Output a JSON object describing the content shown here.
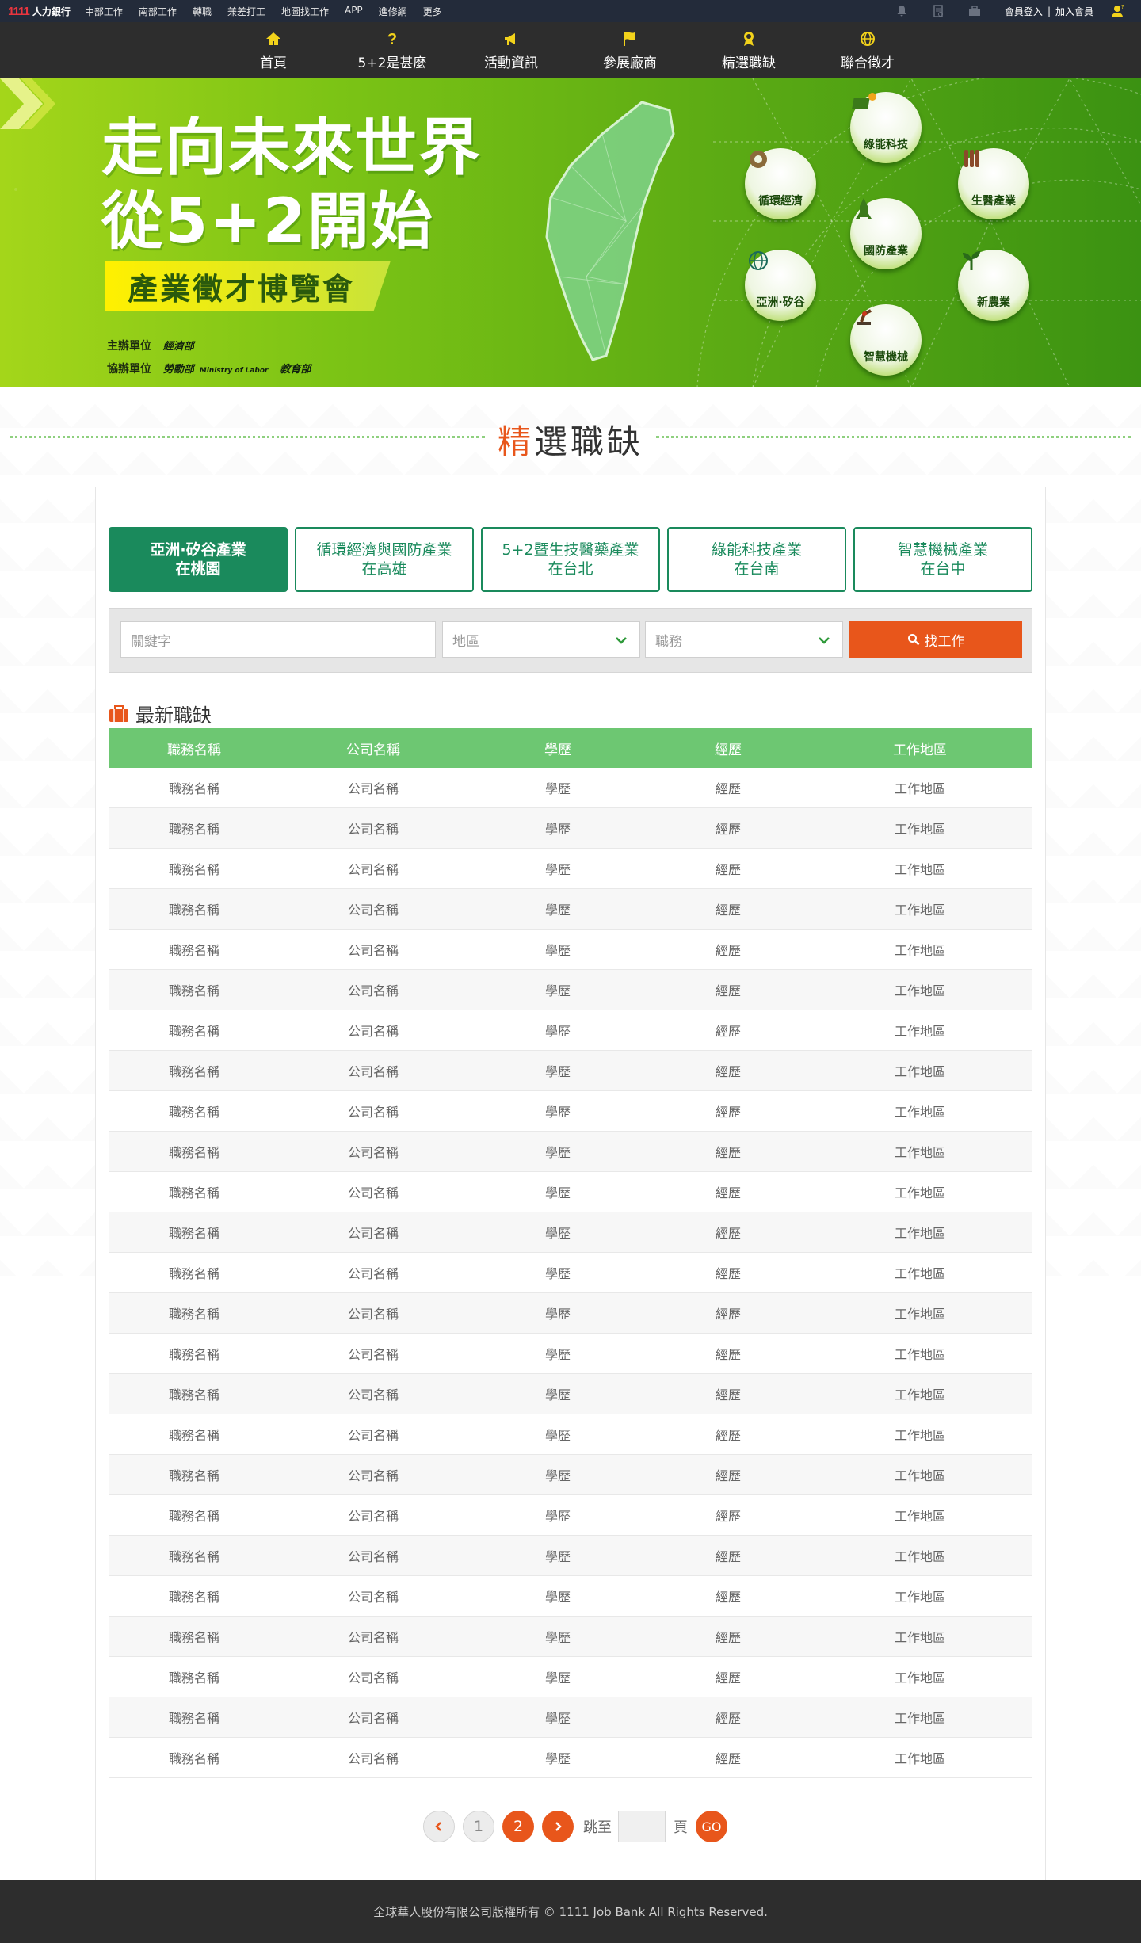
{
  "topbar": {
    "logo_text": "1111",
    "brand_name": "人力銀行",
    "links": [
      "中部工作",
      "南部工作",
      "轉職",
      "兼差打工",
      "地圖找工作",
      "APP",
      "進修網",
      "更多"
    ],
    "login": "會員登入",
    "join": "加入會員",
    "icons": [
      "bell-icon",
      "document-icon",
      "briefcase-icon",
      "user-icon"
    ]
  },
  "nav": [
    {
      "label": "首頁",
      "icon": "home-icon"
    },
    {
      "label": "5+2是甚麼",
      "icon": "question-icon"
    },
    {
      "label": "活動資訊",
      "icon": "megaphone-icon"
    },
    {
      "label": "參展廠商",
      "icon": "flag-icon"
    },
    {
      "label": "精選職缺",
      "icon": "award-icon"
    },
    {
      "label": "聯合徵才",
      "icon": "globe-icon"
    }
  ],
  "banner": {
    "title_line1": "走向未來世界",
    "title_line2": "從5+2開始",
    "ribbon": "產業徵才博覽會",
    "host_label": "主辦單位",
    "host_org": "經濟部",
    "co_label": "協辦單位",
    "co_org1": "勞動部",
    "co_org1_en": "Ministry of Labor",
    "co_org2": "教育部",
    "industries": [
      "綠能科技",
      "循環經濟",
      "生醫產業",
      "國防產業",
      "亞洲·矽谷",
      "新農業",
      "智慧機械"
    ]
  },
  "section": {
    "title_hl": "精",
    "title_rest": "選職缺"
  },
  "tabs": [
    {
      "line1": "亞洲·矽谷產業",
      "line2": "在桃園",
      "active": true
    },
    {
      "line1": "循環經濟與國防產業",
      "line2": "在高雄",
      "active": false
    },
    {
      "line1": "5+2暨生技醫藥產業",
      "line2": "在台北",
      "active": false
    },
    {
      "line1": "綠能科技產業",
      "line2": "在台南",
      "active": false
    },
    {
      "line1": "智慧機械產業",
      "line2": "在台中",
      "active": false
    }
  ],
  "search": {
    "keyword_placeholder": "關鍵字",
    "area_label": "地區",
    "job_label": "職務",
    "button": "找工作"
  },
  "latest_title": "最新職缺",
  "table": {
    "headers": [
      "職務名稱",
      "公司名稱",
      "學歷",
      "經歷",
      "工作地區"
    ],
    "rows": [
      [
        "職務名稱",
        "公司名稱",
        "學歷",
        "經歷",
        "工作地區"
      ],
      [
        "職務名稱",
        "公司名稱",
        "學歷",
        "經歷",
        "工作地區"
      ],
      [
        "職務名稱",
        "公司名稱",
        "學歷",
        "經歷",
        "工作地區"
      ],
      [
        "職務名稱",
        "公司名稱",
        "學歷",
        "經歷",
        "工作地區"
      ],
      [
        "職務名稱",
        "公司名稱",
        "學歷",
        "經歷",
        "工作地區"
      ],
      [
        "職務名稱",
        "公司名稱",
        "學歷",
        "經歷",
        "工作地區"
      ],
      [
        "職務名稱",
        "公司名稱",
        "學歷",
        "經歷",
        "工作地區"
      ],
      [
        "職務名稱",
        "公司名稱",
        "學歷",
        "經歷",
        "工作地區"
      ],
      [
        "職務名稱",
        "公司名稱",
        "學歷",
        "經歷",
        "工作地區"
      ],
      [
        "職務名稱",
        "公司名稱",
        "學歷",
        "經歷",
        "工作地區"
      ],
      [
        "職務名稱",
        "公司名稱",
        "學歷",
        "經歷",
        "工作地區"
      ],
      [
        "職務名稱",
        "公司名稱",
        "學歷",
        "經歷",
        "工作地區"
      ],
      [
        "職務名稱",
        "公司名稱",
        "學歷",
        "經歷",
        "工作地區"
      ],
      [
        "職務名稱",
        "公司名稱",
        "學歷",
        "經歷",
        "工作地區"
      ],
      [
        "職務名稱",
        "公司名稱",
        "學歷",
        "經歷",
        "工作地區"
      ],
      [
        "職務名稱",
        "公司名稱",
        "學歷",
        "經歷",
        "工作地區"
      ],
      [
        "職務名稱",
        "公司名稱",
        "學歷",
        "經歷",
        "工作地區"
      ],
      [
        "職務名稱",
        "公司名稱",
        "學歷",
        "經歷",
        "工作地區"
      ],
      [
        "職務名稱",
        "公司名稱",
        "學歷",
        "經歷",
        "工作地區"
      ],
      [
        "職務名稱",
        "公司名稱",
        "學歷",
        "經歷",
        "工作地區"
      ],
      [
        "職務名稱",
        "公司名稱",
        "學歷",
        "經歷",
        "工作地區"
      ],
      [
        "職務名稱",
        "公司名稱",
        "學歷",
        "經歷",
        "工作地區"
      ],
      [
        "職務名稱",
        "公司名稱",
        "學歷",
        "經歷",
        "工作地區"
      ],
      [
        "職務名稱",
        "公司名稱",
        "學歷",
        "經歷",
        "工作地區"
      ],
      [
        "職務名稱",
        "公司名稱",
        "學歷",
        "經歷",
        "工作地區"
      ]
    ]
  },
  "pager": {
    "pages": [
      "1",
      "2"
    ],
    "current": "2",
    "jump_label": "跳至",
    "page_unit": "頁",
    "go": "GO"
  },
  "footer": "全球華人股份有限公司版權所有 © 1111 Job Bank All Rights Reserved.",
  "colors": {
    "accent": "#e8561b",
    "tab_green": "#1a8a5c",
    "table_header": "#6dc772",
    "nav_bg": "#2d2d2d",
    "topbar_bg": "#232b3a"
  }
}
